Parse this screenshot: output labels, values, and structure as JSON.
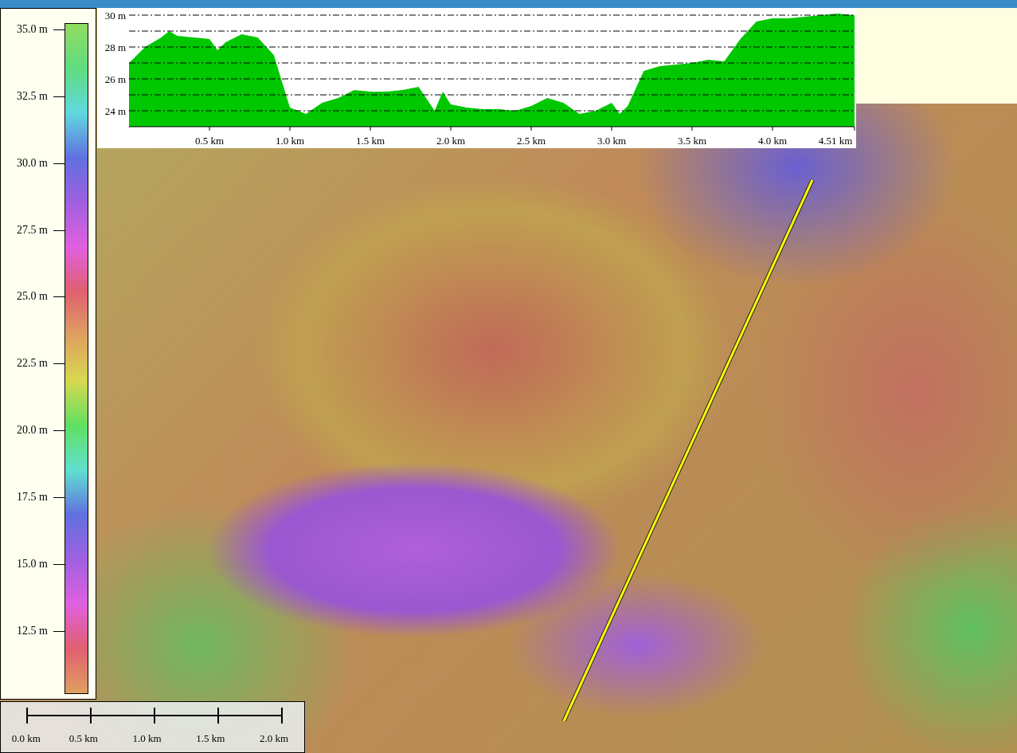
{
  "legend": {
    "labels": [
      "35.0 m",
      "32.5 m",
      "30.0 m",
      "27.5 m",
      "25.0 m",
      "22.5 m",
      "20.0 m",
      "17.5 m",
      "15.0 m",
      "12.5 m"
    ]
  },
  "profile": {
    "chart_data": {
      "type": "area",
      "x": [
        0,
        0.1,
        0.2,
        0.25,
        0.3,
        0.4,
        0.5,
        0.55,
        0.6,
        0.7,
        0.8,
        0.9,
        1.0,
        1.1,
        1.2,
        1.3,
        1.4,
        1.5,
        1.6,
        1.7,
        1.8,
        1.9,
        1.95,
        2.0,
        2.1,
        2.2,
        2.3,
        2.4,
        2.5,
        2.6,
        2.7,
        2.8,
        2.9,
        3.0,
        3.05,
        3.1,
        3.2,
        3.3,
        3.4,
        3.5,
        3.6,
        3.7,
        3.8,
        3.9,
        4.0,
        4.1,
        4.2,
        4.3,
        4.4,
        4.51
      ],
      "grid": true,
      "series": [
        {
          "color": "#00c800",
          "values": [
            27.0,
            28.0,
            28.6,
            29.0,
            28.7,
            28.6,
            28.5,
            27.8,
            28.3,
            28.8,
            28.6,
            27.5,
            24.2,
            23.8,
            24.5,
            24.8,
            25.3,
            25.2,
            25.2,
            25.3,
            25.5,
            24.0,
            25.2,
            24.4,
            24.2,
            24.1,
            24.1,
            24.0,
            24.3,
            24.8,
            24.5,
            23.8,
            24.0,
            24.5,
            23.8,
            24.3,
            26.5,
            26.8,
            26.9,
            27.0,
            27.2,
            27.1,
            28.5,
            29.6,
            29.8,
            29.8,
            29.9,
            30.0,
            30.1,
            30.0
          ]
        }
      ],
      "xlim": [
        0,
        4.51
      ],
      "ylim": [
        23,
        30.1
      ],
      "xticks": [
        {
          "value": 0.5,
          "label": "0.5 km"
        },
        {
          "value": 1.0,
          "label": "1.0 km"
        },
        {
          "value": 1.5,
          "label": "1.5 km"
        },
        {
          "value": 2.0,
          "label": "2.0 km"
        },
        {
          "value": 2.5,
          "label": "2.5 km"
        },
        {
          "value": 3.0,
          "label": "3.0 km"
        },
        {
          "value": 3.5,
          "label": "3.5 km"
        },
        {
          "value": 4.0,
          "label": "4.0 km"
        },
        {
          "value": 4.51,
          "label": "4.51 km"
        }
      ],
      "yticks": [
        {
          "value": 24,
          "label": "24 m"
        },
        {
          "value": 26,
          "label": "26 m"
        },
        {
          "value": 28,
          "label": "28 m"
        },
        {
          "value": 30,
          "label": "30 m"
        }
      ]
    }
  },
  "scale_bar": {
    "labels": [
      "0.0 km",
      "0.5 km",
      "1.0 km",
      "1.5 km",
      "2.0 km"
    ]
  }
}
